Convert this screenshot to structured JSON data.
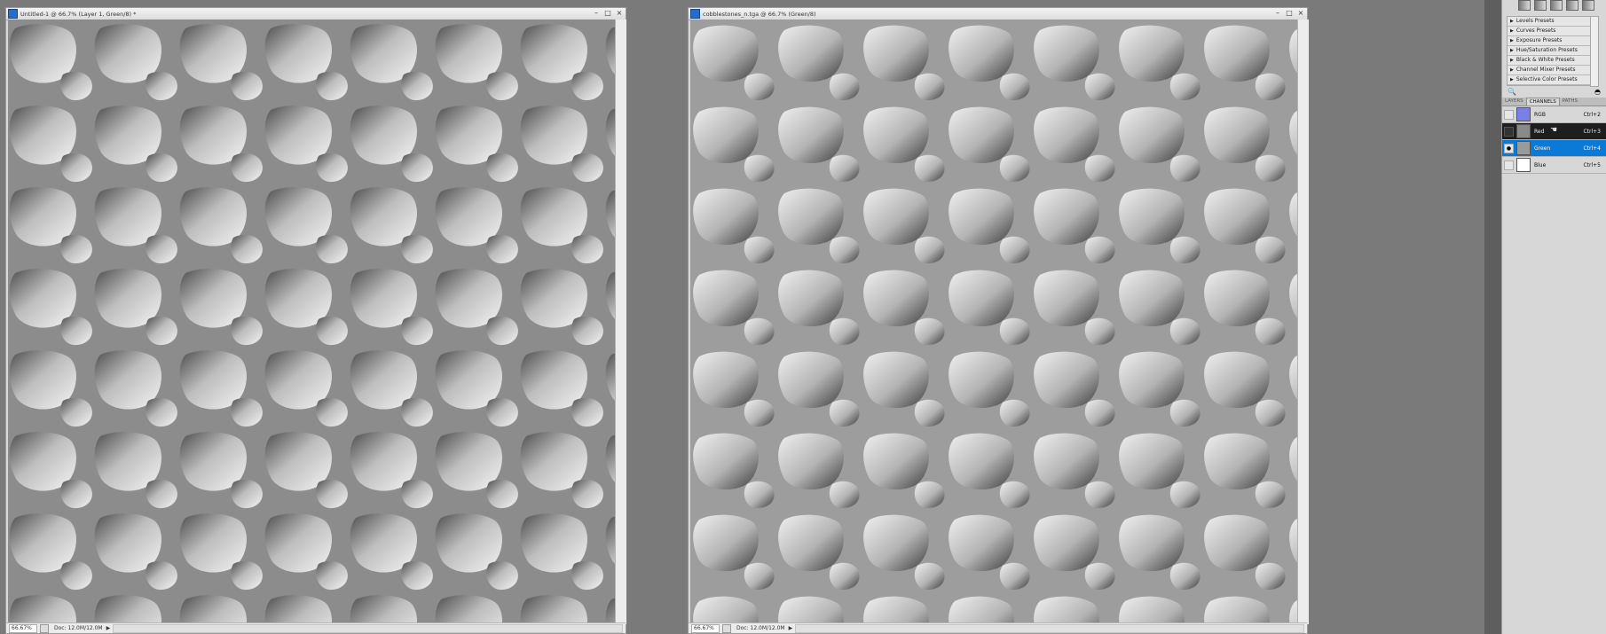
{
  "documents": [
    {
      "title": "Untitled-1 @ 66.7% (Layer 1, Green/8) *",
      "zoom": "66.67%",
      "doc_info": "Doc: 12.0M/12.0M"
    },
    {
      "title": "cobblestones_n.tga @ 66.7% (Green/8)",
      "zoom": "66.67%",
      "doc_info": "Doc: 12.0M/12.0M"
    }
  ],
  "adjustments": {
    "presets": [
      "Levels Presets",
      "Curves Presets",
      "Exposure Presets",
      "Hue/Saturation Presets",
      "Black & White Presets",
      "Channel Mixer Presets",
      "Selective Color Presets"
    ]
  },
  "panel_tabs": [
    "LAYERS",
    "CHANNELS",
    "PATHS"
  ],
  "active_tab": "CHANNELS",
  "channels": [
    {
      "name": "RGB",
      "shortcut": "Ctrl+2",
      "visible": false,
      "selected": false,
      "thumb_color": "#7b7fe8"
    },
    {
      "name": "Red",
      "shortcut": "Ctrl+3",
      "visible": false,
      "selected": false,
      "thumb_color": "#8a8a8a"
    },
    {
      "name": "Green",
      "shortcut": "Ctrl+4",
      "visible": true,
      "selected": true,
      "thumb_color": "#9a9a9a"
    },
    {
      "name": "Blue",
      "shortcut": "Ctrl+5",
      "visible": false,
      "selected": false,
      "thumb_color": "#ffffff"
    }
  ],
  "colors": {
    "selected_row": "#0b79d6",
    "dark_row": "#1e1e1e",
    "workspace": "#7a7a7a",
    "title_icon": "#2a6cc4"
  }
}
